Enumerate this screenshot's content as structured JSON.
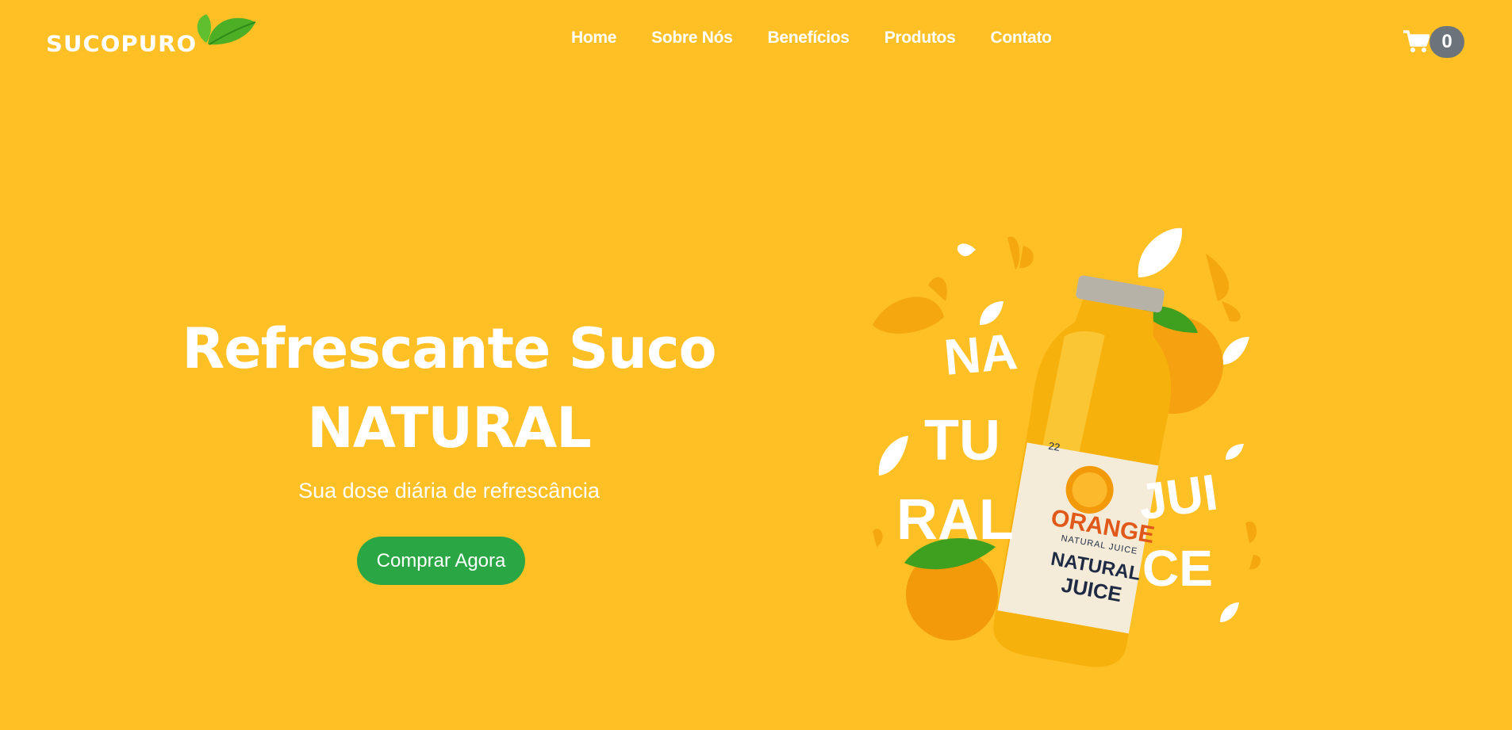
{
  "brand": {
    "name": "SUCOPURO"
  },
  "nav": {
    "items": [
      "Home",
      "Sobre Nós",
      "Benefícios",
      "Produtos",
      "Contato"
    ]
  },
  "cart": {
    "count": "0",
    "icon": "shopping-cart-icon"
  },
  "hero": {
    "title_line1": "Refrescante Suco",
    "title_line2": "NATURAL",
    "subtitle": "Sua dose diária de refrescância",
    "cta_label": "Comprar Agora"
  },
  "product_visual": {
    "words": [
      "NA",
      "TU",
      "RAL",
      "JUI",
      "CE"
    ],
    "label": {
      "number": "22",
      "brand": "ORANGE",
      "tagline": "NATURAL JUICE",
      "line1": "NATURAL",
      "line2": "JUICE"
    }
  },
  "colors": {
    "background": "#FFC026",
    "cta": "#2aa744",
    "badge": "#6c737b",
    "leaf": "#4caf26"
  }
}
